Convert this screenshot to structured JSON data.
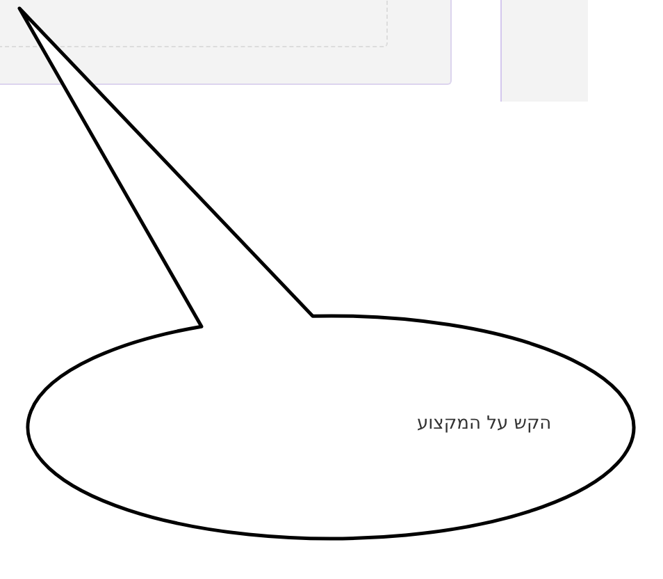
{
  "callout": {
    "text": "הקש על המקצוע"
  }
}
